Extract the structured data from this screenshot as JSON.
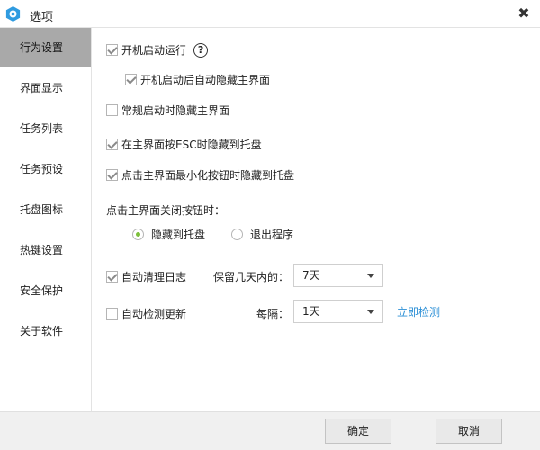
{
  "window": {
    "title": "选项",
    "close_glyph": "✖"
  },
  "sidebar": {
    "items": [
      {
        "label": "行为设置",
        "active": true
      },
      {
        "label": "界面显示"
      },
      {
        "label": "任务列表"
      },
      {
        "label": "任务预设"
      },
      {
        "label": "托盘图标"
      },
      {
        "label": "热键设置"
      },
      {
        "label": "安全保护"
      },
      {
        "label": "关于软件"
      }
    ]
  },
  "options": {
    "autostart": {
      "label": "开机启动运行",
      "checked": true,
      "help_glyph": "?"
    },
    "autostart_hide": {
      "label": "开机启动后自动隐藏主界面",
      "checked": true
    },
    "normal_hide": {
      "label": "常规启动时隐藏主界面",
      "checked": false
    },
    "esc_tray": {
      "label": "在主界面按ESC时隐藏到托盘",
      "checked": true
    },
    "minimize_tray": {
      "label": "点击主界面最小化按钮时隐藏到托盘",
      "checked": true
    }
  },
  "close_behavior": {
    "label": "点击主界面关闭按钮时：",
    "options": [
      {
        "label": "隐藏到托盘",
        "selected": true
      },
      {
        "label": "退出程序",
        "selected": false
      }
    ]
  },
  "log_cleanup": {
    "label": "自动清理日志",
    "checked": true,
    "keep_label": "保留几天内的：",
    "keep_value": "7天"
  },
  "auto_update": {
    "label": "自动检测更新",
    "checked": false,
    "interval_label": "每隔：",
    "interval_value": "1天",
    "check_now": "立即检测"
  },
  "footer": {
    "ok_label": "确定",
    "cancel_label": "取消"
  },
  "colors": {
    "accent": "#2b8fd6",
    "radio_selected": "#7cbf3a",
    "sidebar_active": "#a9a9a9"
  }
}
